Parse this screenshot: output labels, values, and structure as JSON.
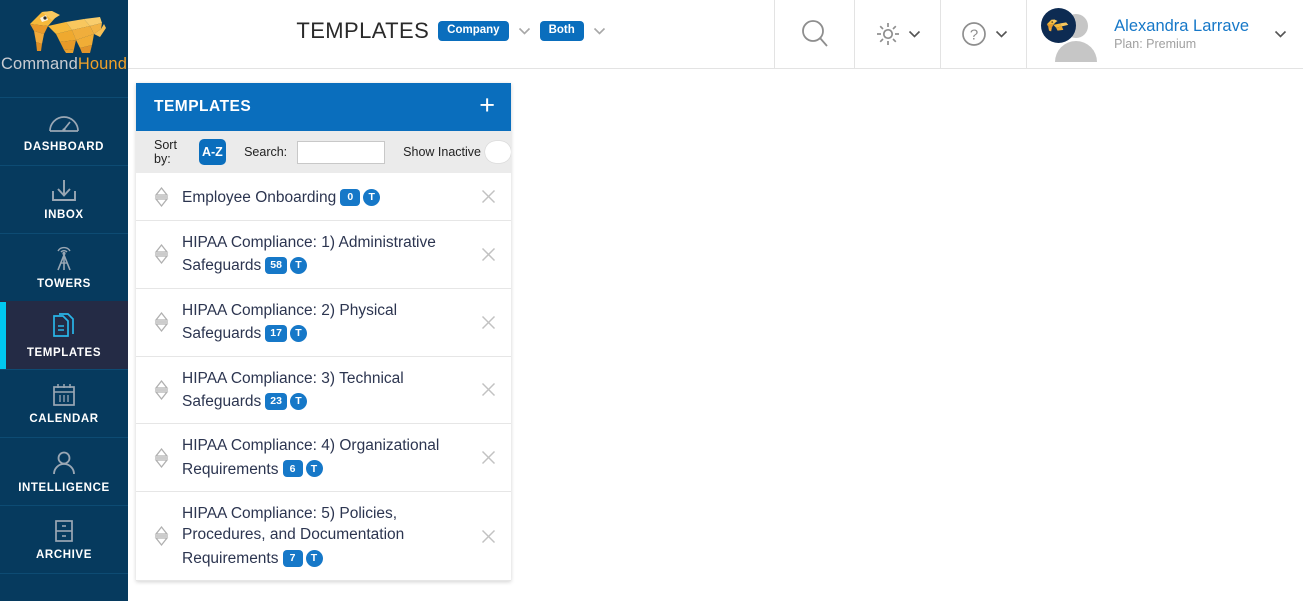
{
  "brand": {
    "name_part1": "Command",
    "name_part2": "Hound",
    "logo_icon": "dog-logo-icon",
    "colors": {
      "sidebar": "#063a5e",
      "accent_blue": "#0a6ebd",
      "active_cyan": "#00c8f0",
      "badge_blue": "#1678c8",
      "logo_orange": "#f0a129"
    }
  },
  "sidebar": {
    "items": [
      {
        "label": "DASHBOARD",
        "icon": "gauge-icon",
        "active": false
      },
      {
        "label": "INBOX",
        "icon": "inbox-download-icon",
        "active": false
      },
      {
        "label": "TOWERS",
        "icon": "tower-antenna-icon",
        "active": false
      },
      {
        "label": "TEMPLATES",
        "icon": "documents-icon",
        "active": true
      },
      {
        "label": "CALENDAR",
        "icon": "calendar-icon",
        "active": false
      },
      {
        "label": "INTELLIGENCE",
        "icon": "person-icon",
        "active": false
      },
      {
        "label": "ARCHIVE",
        "icon": "file-cabinet-icon",
        "active": false
      }
    ]
  },
  "header": {
    "title": "TEMPLATES",
    "scope_pill": "Company",
    "scope_chevron": "chevron-down-icon",
    "filter_pill": "Both",
    "filter_chevron": "chevron-down-icon",
    "search_icon": "search-icon",
    "settings_icon": "gear-icon",
    "settings_chevron": "chevron-down-icon",
    "help_icon": "question-mark-icon",
    "help_chevron": "chevron-down-icon",
    "user": {
      "name": "Alexandra Larrave",
      "plan": "Plan: Premium",
      "avatar_icon": "user-avatar-icon",
      "menu_chevron": "chevron-down-icon"
    }
  },
  "panel": {
    "title": "TEMPLATES",
    "add_button": "+",
    "toolbar": {
      "sort_label": "Sort by:",
      "sort_value": "A-Z",
      "search_label": "Search:",
      "search_value": "",
      "search_placeholder": "",
      "show_inactive_label": "Show Inactive",
      "show_inactive_on": false
    },
    "items": [
      {
        "title": "Employee Onboarding",
        "count": "0",
        "type_badge": "T"
      },
      {
        "title": "HIPAA Compliance: 1) Administrative Safeguards",
        "count": "58",
        "type_badge": "T"
      },
      {
        "title": "HIPAA Compliance: 2) Physical Safeguards",
        "count": "17",
        "type_badge": "T"
      },
      {
        "title": "HIPAA Compliance: 3) Technical Safeguards",
        "count": "23",
        "type_badge": "T"
      },
      {
        "title": "HIPAA Compliance: 4) Organizational Requirements",
        "count": "6",
        "type_badge": "T"
      },
      {
        "title": "HIPAA Compliance: 5) Policies, Procedures, and Documentation Requirements",
        "count": "7",
        "type_badge": "T"
      }
    ],
    "row_remove_icon": "close-x-icon",
    "row_drag_icon": "drag-updown-icon"
  }
}
